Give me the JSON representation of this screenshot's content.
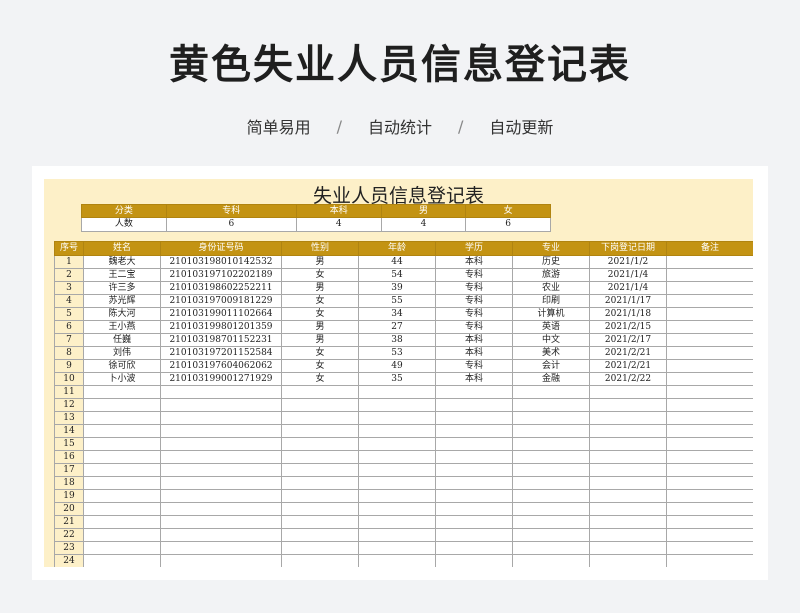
{
  "page": {
    "title": "黄色失业人员信息登记表",
    "subtitle": [
      "简单易用",
      "自动统计",
      "自动更新"
    ],
    "subtitle_separator": "/"
  },
  "sheet": {
    "title": "失业人员信息登记表",
    "summary": {
      "headers": [
        "分类",
        "专科",
        "本科",
        "男",
        "女"
      ],
      "row": [
        "人数",
        "6",
        "4",
        "4",
        "6"
      ]
    },
    "columns": [
      "序号",
      "姓名",
      "身份证号码",
      "性别",
      "年龄",
      "学历",
      "专业",
      "下岗登记日期",
      "备注"
    ],
    "rows": [
      [
        "1",
        "魏老大",
        "210103198010142532",
        "男",
        "44",
        "本科",
        "历史",
        "2021/1/2",
        ""
      ],
      [
        "2",
        "王二宝",
        "210103197102202189",
        "女",
        "54",
        "专科",
        "旅游",
        "2021/1/4",
        ""
      ],
      [
        "3",
        "许三多",
        "210103198602252211",
        "男",
        "39",
        "专科",
        "农业",
        "2021/1/4",
        ""
      ],
      [
        "4",
        "苏光辉",
        "210103197009181229",
        "女",
        "55",
        "专科",
        "印刷",
        "2021/1/17",
        ""
      ],
      [
        "5",
        "陈大河",
        "210103199011102664",
        "女",
        "34",
        "专科",
        "计算机",
        "2021/1/18",
        ""
      ],
      [
        "6",
        "王小燕",
        "210103199801201359",
        "男",
        "27",
        "专科",
        "英语",
        "2021/2/15",
        ""
      ],
      [
        "7",
        "任巍",
        "210103198701152231",
        "男",
        "38",
        "本科",
        "中文",
        "2021/2/17",
        ""
      ],
      [
        "8",
        "刘伟",
        "210103197201152584",
        "女",
        "53",
        "本科",
        "美术",
        "2021/2/21",
        ""
      ],
      [
        "9",
        "徐可欣",
        "210103197604062062",
        "女",
        "49",
        "专科",
        "会计",
        "2021/2/21",
        ""
      ],
      [
        "10",
        "卜小波",
        "210103199001271929",
        "女",
        "35",
        "本科",
        "金融",
        "2021/2/22",
        ""
      ],
      [
        "11",
        "",
        "",
        "",
        "",
        "",
        "",
        "",
        ""
      ],
      [
        "12",
        "",
        "",
        "",
        "",
        "",
        "",
        "",
        ""
      ],
      [
        "13",
        "",
        "",
        "",
        "",
        "",
        "",
        "",
        ""
      ],
      [
        "14",
        "",
        "",
        "",
        "",
        "",
        "",
        "",
        ""
      ],
      [
        "15",
        "",
        "",
        "",
        "",
        "",
        "",
        "",
        ""
      ],
      [
        "16",
        "",
        "",
        "",
        "",
        "",
        "",
        "",
        ""
      ],
      [
        "17",
        "",
        "",
        "",
        "",
        "",
        "",
        "",
        ""
      ],
      [
        "18",
        "",
        "",
        "",
        "",
        "",
        "",
        "",
        ""
      ],
      [
        "19",
        "",
        "",
        "",
        "",
        "",
        "",
        "",
        ""
      ],
      [
        "20",
        "",
        "",
        "",
        "",
        "",
        "",
        "",
        ""
      ],
      [
        "21",
        "",
        "",
        "",
        "",
        "",
        "",
        "",
        ""
      ],
      [
        "22",
        "",
        "",
        "",
        "",
        "",
        "",
        "",
        ""
      ],
      [
        "23",
        "",
        "",
        "",
        "",
        "",
        "",
        "",
        ""
      ],
      [
        "24",
        "",
        "",
        "",
        "",
        "",
        "",
        "",
        ""
      ]
    ]
  },
  "colors": {
    "header_gold": "#c39313",
    "sheet_background": "#fdf0c8",
    "page_background": "#f2f3f5"
  }
}
